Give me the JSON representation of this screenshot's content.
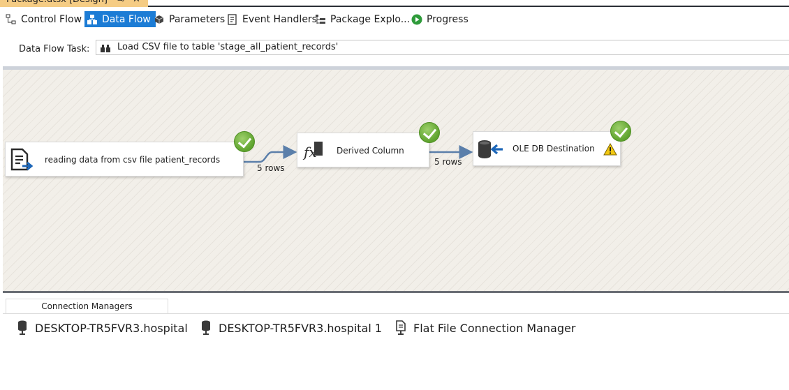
{
  "document_tab": {
    "title": "Package.dtsx [Design]",
    "pin_glyph": "⊸",
    "close_glyph": "✕"
  },
  "designer_tabs": [
    {
      "label": "Control Flow",
      "icon": "control-flow-icon",
      "active": false
    },
    {
      "label": "Data Flow",
      "icon": "data-flow-icon",
      "active": true
    },
    {
      "label": "Parameters",
      "icon": "parameters-icon",
      "active": false
    },
    {
      "label": "Event Handlers",
      "icon": "event-handlers-icon",
      "active": false
    },
    {
      "label": "Package Explo...",
      "icon": "package-explorer-icon",
      "active": false
    },
    {
      "label": "Progress",
      "icon": "progress-icon",
      "active": false
    }
  ],
  "task_selector": {
    "label": "Data Flow Task:",
    "value": "Load CSV file to table 'stage_all_patient_records'",
    "icon": "data-flow-task-icon"
  },
  "components": [
    {
      "label": "reading data from csv file patient_records",
      "icon": "flat-file-source-icon",
      "status": "success"
    },
    {
      "label": "Derived Column",
      "icon": "derived-column-icon",
      "status": "success"
    },
    {
      "label": "OLE DB Destination",
      "icon": "ole-db-destination-icon",
      "status": "success",
      "warning": true
    }
  ],
  "paths": [
    {
      "rows": "5 rows"
    },
    {
      "rows": "5 rows"
    }
  ],
  "connection_managers": {
    "tab_label": "Connection Managers",
    "items": [
      {
        "label": "DESKTOP-TR5FVR3.hospital",
        "icon": "ole-db-connection-icon"
      },
      {
        "label": "DESKTOP-TR5FVR3.hospital 1",
        "icon": "ole-db-connection-icon"
      },
      {
        "label": "Flat File Connection Manager",
        "icon": "flat-file-connection-icon"
      }
    ]
  },
  "colors": {
    "active_tab": "#1c7cd5",
    "document_tab": "#f5cc84",
    "success": "#5ea32e",
    "warning": "#f2c811",
    "path_arrow": "#5b7faa"
  }
}
